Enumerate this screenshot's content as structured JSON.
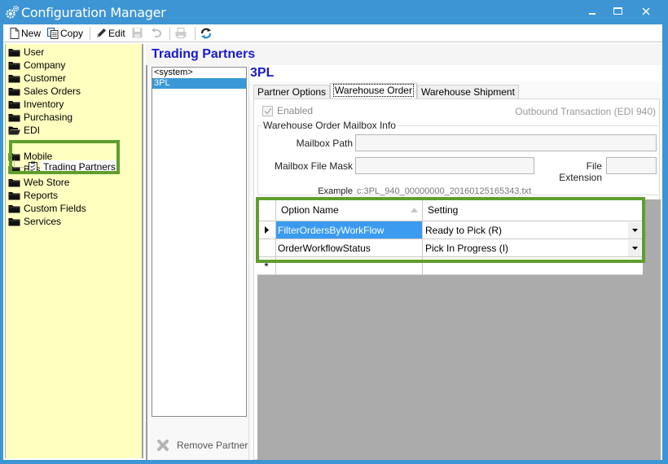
{
  "window": {
    "title": "Configuration Manager",
    "controls": {
      "minimize": "minimize",
      "maximize": "maximize",
      "close": "close"
    }
  },
  "toolbar": {
    "new_label": "New",
    "copy_label": "Copy",
    "edit_label": "Edit"
  },
  "sidebar": {
    "items": [
      {
        "label": "User"
      },
      {
        "label": "Company"
      },
      {
        "label": "Customer"
      },
      {
        "label": "Sales Orders"
      },
      {
        "label": "Inventory"
      },
      {
        "label": "Purchasing"
      },
      {
        "label": "EDI"
      },
      {
        "label": "Mobile"
      },
      {
        "label": "Business Activities"
      },
      {
        "label": "Web Store"
      },
      {
        "label": "Reports"
      },
      {
        "label": "Custom Fields"
      },
      {
        "label": "Services"
      }
    ],
    "edi_child": {
      "label": "Trading Partners"
    }
  },
  "main": {
    "title": "Trading Partners",
    "partners": [
      {
        "label": "<system>"
      },
      {
        "label": "3PL"
      }
    ],
    "selected_partner": "3PL",
    "remove_partner_label": "Remove Partner",
    "tabs": [
      {
        "label": "Partner Options"
      },
      {
        "label": "Warehouse Order"
      },
      {
        "label": "Warehouse Shipment"
      }
    ],
    "active_tab": "Warehouse Order",
    "enabled_label": "Enabled",
    "enabled_checked": true,
    "outbound_label": "Outbound Transaction (EDI 940)",
    "mailbox_group_title": "Warehouse Order Mailbox Info",
    "mailbox_path_label": "Mailbox Path",
    "mailbox_path_value": "",
    "mailbox_file_mask_label": "Mailbox File Mask",
    "mailbox_file_mask_value": "",
    "file_extension_label": "File Extension",
    "file_extension_value": "",
    "example_label": "Example",
    "example_value": "c:3PL_940_00000000_20160125165343.txt",
    "grid": {
      "columns": [
        "Option Name",
        "Setting"
      ],
      "rows": [
        {
          "option": "FilterOrdersByWorkFlow",
          "setting": "Ready to Pick (R)"
        },
        {
          "option": "OrderWorkflowStatus",
          "setting": "Pick In Progress (I)"
        }
      ],
      "new_row_marker": "*"
    }
  },
  "colors": {
    "titlebar": "#3d95d3",
    "tree_bg": "#ffffc0",
    "heading_blue": "#1a1acc",
    "selection": "#3b98d6",
    "highlight_green": "#5f9e2e",
    "grid_empty": "#ababab"
  }
}
